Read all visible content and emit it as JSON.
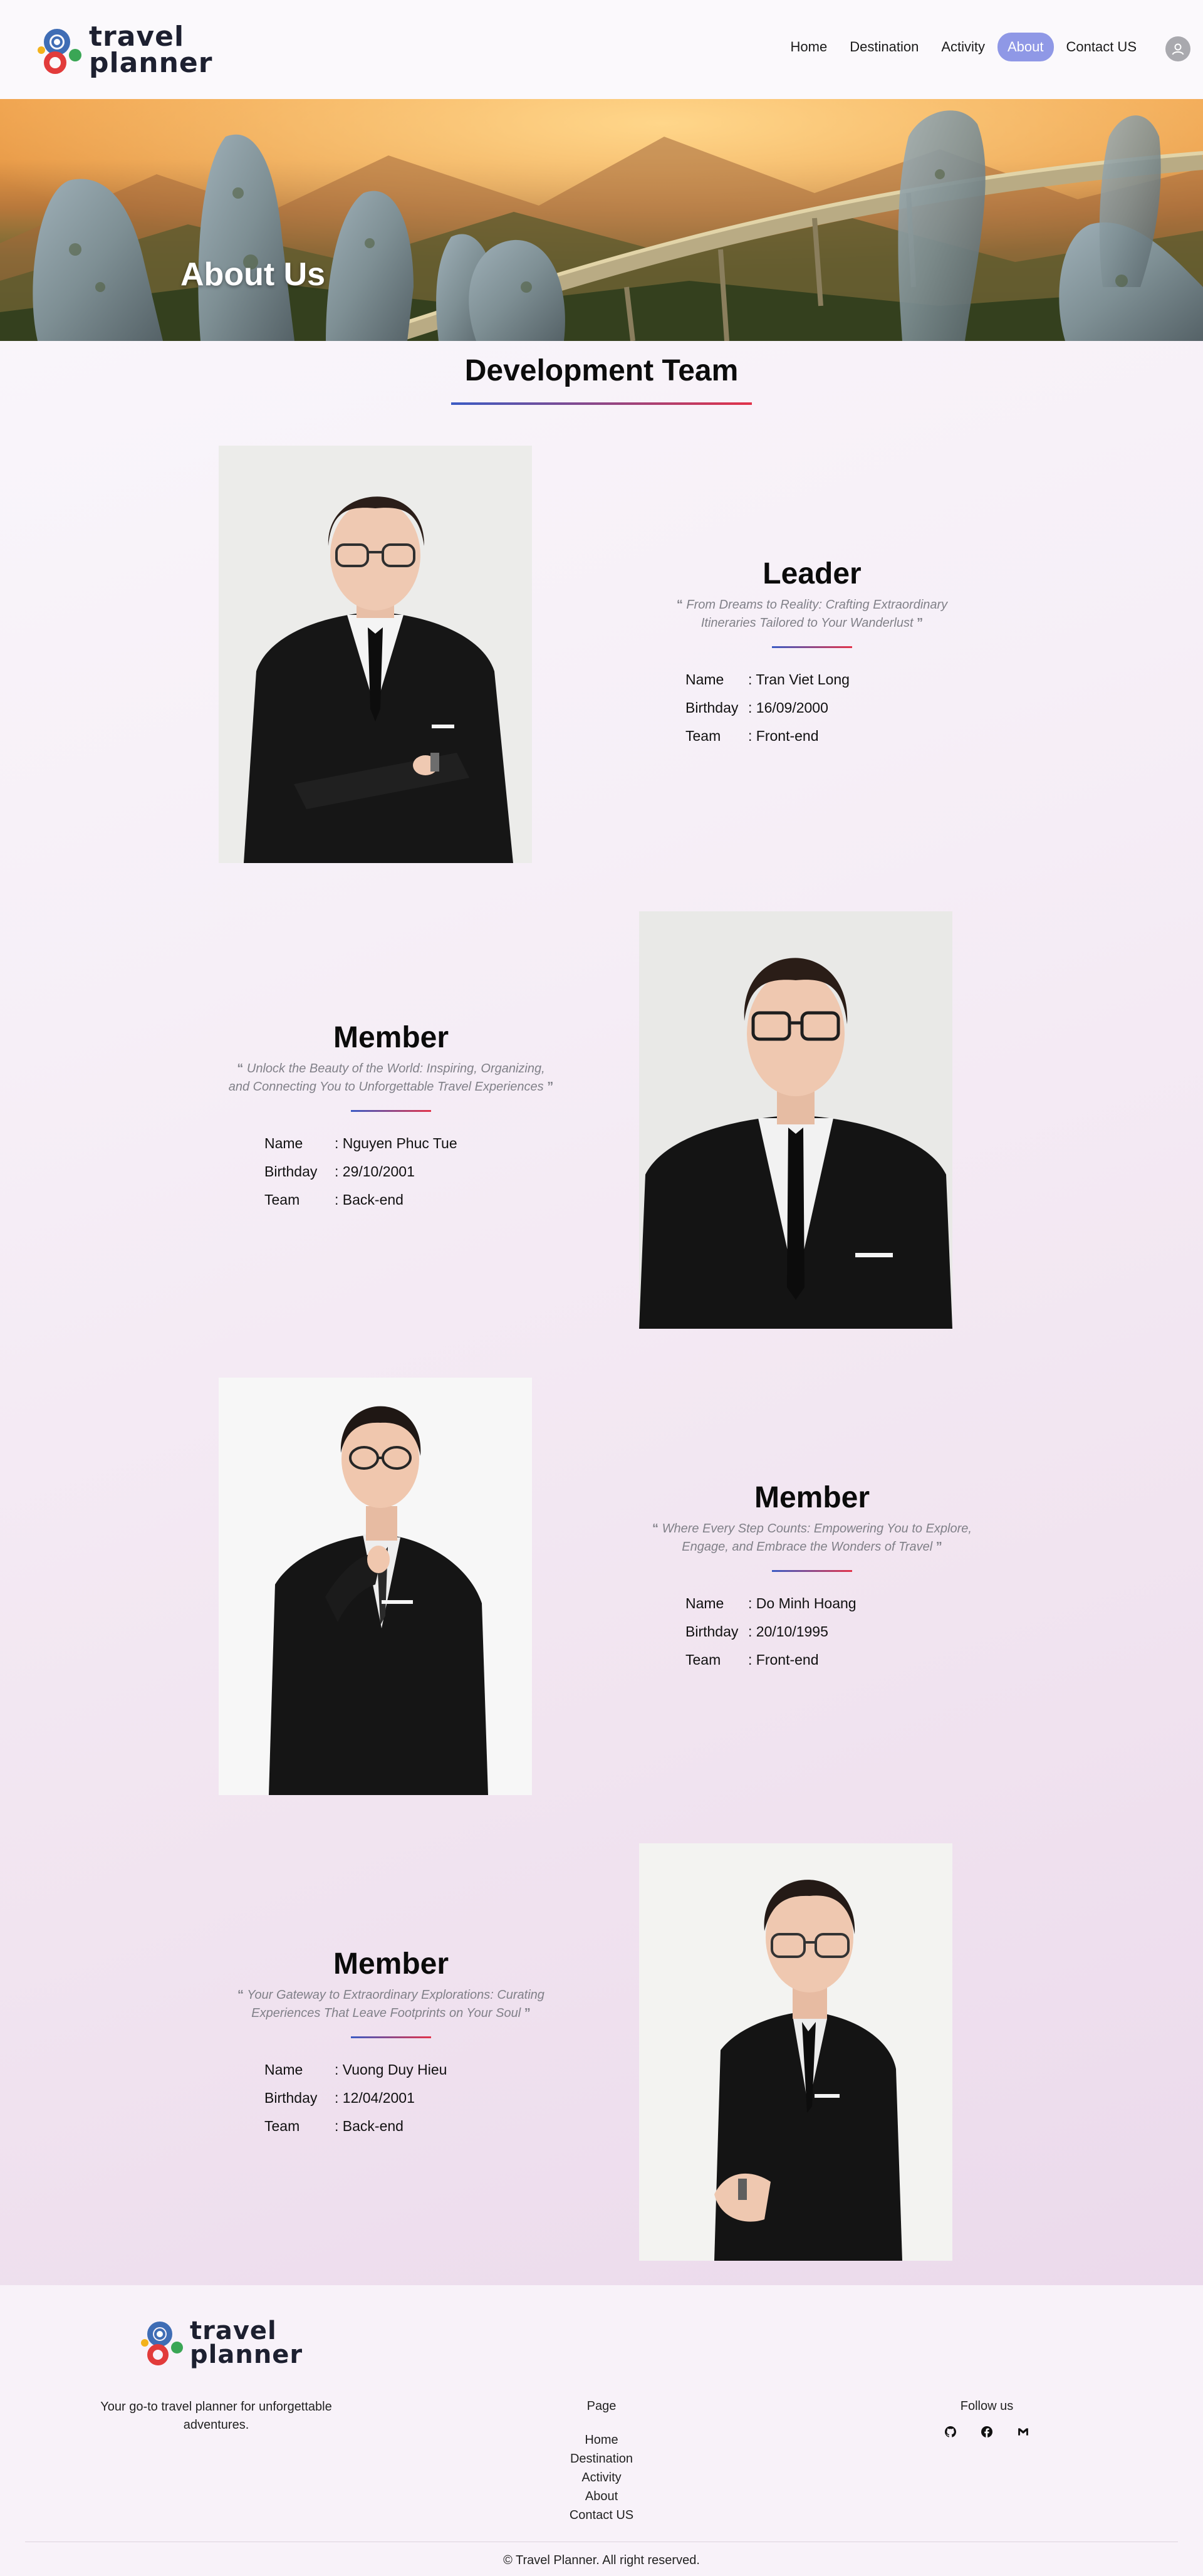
{
  "brand": {
    "line1": "travel",
    "line2": "planner",
    "colors": {
      "blue": "#3f6db5",
      "red": "#e23b3b",
      "green": "#3aa655",
      "yellow": "#f3b21c"
    }
  },
  "nav": {
    "items": [
      "Home",
      "Destination",
      "Activity",
      "About",
      "Contact US"
    ],
    "active": "About",
    "avatar_icon": "user-icon"
  },
  "hero": {
    "title": "About Us"
  },
  "section": {
    "title": "Development Team"
  },
  "labels": {
    "name": "Name",
    "birthday": "Birthday",
    "team": "Team"
  },
  "members": [
    {
      "role": "Leader",
      "quote": "From Dreams to Reality: Crafting Extraordinary Itineraries Tailored to Your Wanderlust",
      "name": ": Tran Viet Long",
      "birthday": ": 16/09/2000",
      "team": ": Front-end"
    },
    {
      "role": "Member",
      "quote": "Unlock the Beauty of the World: Inspiring, Organizing, and Connecting You to Unforgettable Travel Experiences",
      "name": ": Nguyen Phuc Tue",
      "birthday": ": 29/10/2001",
      "team": ": Back-end"
    },
    {
      "role": "Member",
      "quote": "Where Every Step Counts: Empowering You to Explore, Engage, and Embrace the Wonders of Travel",
      "name": ": Do Minh Hoang",
      "birthday": ": 20/10/1995",
      "team": ": Front-end"
    },
    {
      "role": "Member",
      "quote": "Your Gateway to Extraordinary Explorations: Curating Experiences That Leave Footprints on Your Soul",
      "name": ": Vuong Duy Hieu",
      "birthday": ": 12/04/2001",
      "team": ": Back-end"
    }
  ],
  "quote_marks": {
    "open": "“",
    "close": "”"
  },
  "footer": {
    "tagline": "Your go-to travel planner for unforgettable adventures.",
    "page_title": "Page",
    "links": [
      "Home",
      "Destination",
      "Activity",
      "About",
      "Contact US"
    ],
    "follow_title": "Follow us",
    "social_icons": [
      "github-icon",
      "facebook-icon",
      "gmail-icon"
    ],
    "copyright": "© Travel Planner. All right reserved."
  }
}
